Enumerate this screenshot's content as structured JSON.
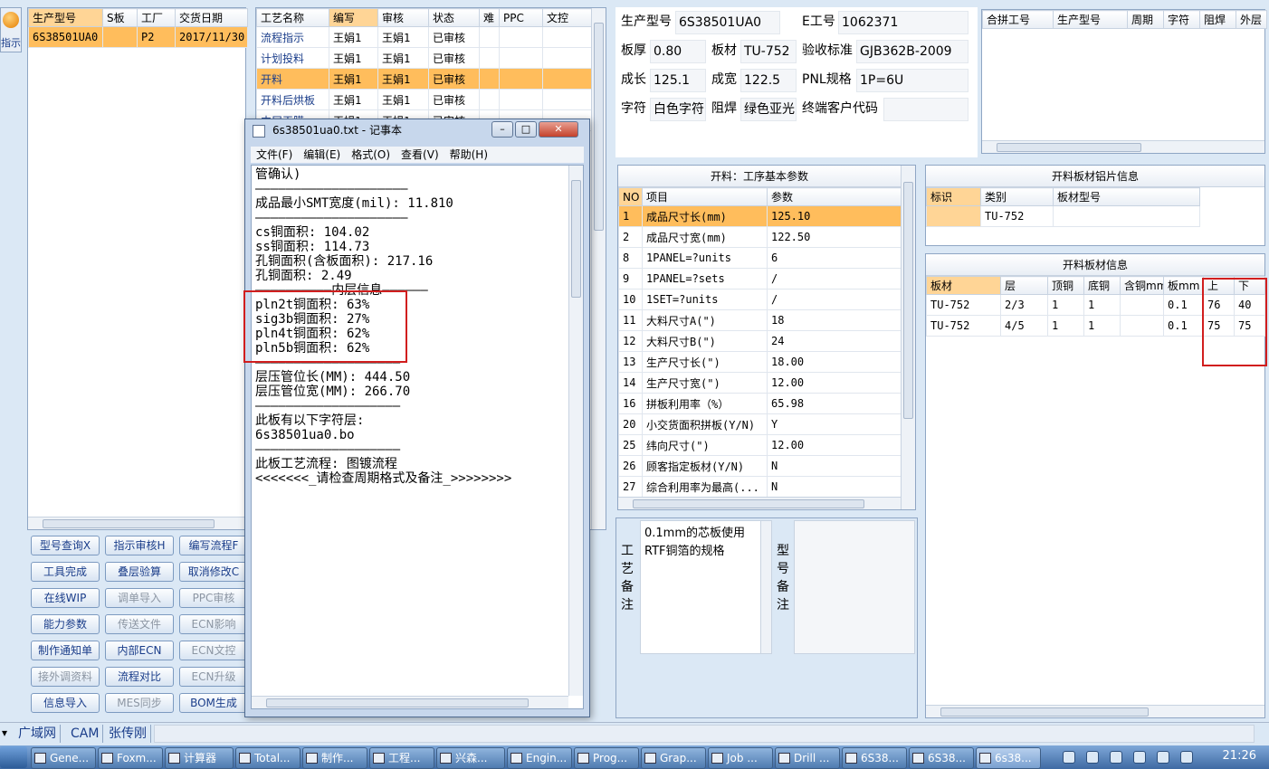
{
  "left_strip": {
    "icon_label": "指示"
  },
  "order_grid": {
    "headers": [
      "生产型号",
      "S板",
      "工厂",
      "交货日期"
    ],
    "rows": [
      [
        "6S38501UA0",
        "",
        "P2",
        "2017/11/30"
      ]
    ]
  },
  "process_grid": {
    "headers": [
      "工艺名称",
      "编写",
      "审核",
      "状态",
      "难",
      "PPC",
      "文控"
    ],
    "rows": [
      [
        "流程指示",
        "王娟1",
        "王娟1",
        "已审核",
        "",
        "",
        ""
      ],
      [
        "计划投料",
        "王娟1",
        "王娟1",
        "已审核",
        "",
        "",
        ""
      ],
      [
        "开料",
        "王娟1",
        "王娟1",
        "已审核",
        "",
        "",
        ""
      ],
      [
        "开料后烘板",
        "王娟1",
        "王娟1",
        "已审核",
        "",
        "",
        ""
      ],
      [
        "内层干膜",
        "王娟1",
        "王娟1",
        "已审核",
        "",
        "",
        ""
      ]
    ]
  },
  "buttons": [
    [
      "型号查询X",
      "指示审核H",
      "编写流程F"
    ],
    [
      "工具完成",
      "叠层验算",
      "取消修改C"
    ],
    [
      "在线WIP",
      "调单导入",
      "PPC审核"
    ],
    [
      "能力参数",
      "传送文件",
      "ECN影响"
    ],
    [
      "制作通知单",
      "内部ECN",
      "ECN文控"
    ],
    [
      "接外调资料",
      "流程对比",
      "ECN升级"
    ],
    [
      "信息导入",
      "MES同步",
      "BOM生成"
    ]
  ],
  "buttons_disabled": [
    [
      false,
      false,
      false
    ],
    [
      false,
      false,
      false
    ],
    [
      false,
      true,
      true
    ],
    [
      false,
      true,
      true
    ],
    [
      false,
      false,
      true
    ],
    [
      true,
      false,
      true
    ],
    [
      false,
      true,
      false
    ]
  ],
  "info": {
    "prod_model_lbl": "生产型号",
    "prod_model": "6S38501UA0",
    "e_no_lbl": "E工号",
    "e_no": "1062371",
    "thick_lbl": "板厚",
    "thick": "0.80",
    "material_lbl": "板材",
    "material": "TU-752",
    "std_lbl": "验收标准",
    "std": "GJB362B-2009",
    "len_lbl": "成长",
    "len": "125.1",
    "wid_lbl": "成宽",
    "wid": "122.5",
    "pnl_lbl": "PNL规格",
    "pnl": "1P=6U",
    "char_lbl": "字符",
    "char": "白色字符",
    "mask_lbl": "阻焊",
    "mask": "绿色亚光",
    "cust_lbl": "终端客户代码",
    "cust": ""
  },
  "merge_grid": {
    "headers": [
      "合拼工号",
      "生产型号",
      "周期",
      "字符",
      "阻焊",
      "外层"
    ]
  },
  "param_grid": {
    "title": "开料：工序基本参数",
    "headers": [
      "NO",
      "项目",
      "参数"
    ],
    "rows": [
      [
        "1",
        "成品尺寸长(mm)",
        "125.10"
      ],
      [
        "2",
        "成品尺寸宽(mm)",
        "122.50"
      ],
      [
        "8",
        "1PANEL=?units",
        "6"
      ],
      [
        "9",
        "1PANEL=?sets",
        "/"
      ],
      [
        "10",
        "1SET=?units",
        "/"
      ],
      [
        "11",
        "大料尺寸A(\")",
        "18"
      ],
      [
        "12",
        "大料尺寸B(\")",
        "24"
      ],
      [
        "13",
        "生产尺寸长(\")",
        "18.00"
      ],
      [
        "14",
        "生产尺寸宽(\")",
        "12.00"
      ],
      [
        "16",
        "拼板利用率（%）",
        "65.98"
      ],
      [
        "20",
        "小交货面积拼板(Y/N)",
        "Y"
      ],
      [
        "25",
        "纬向尺寸(\")",
        "12.00"
      ],
      [
        "26",
        "顾客指定板材(Y/N)",
        "N"
      ],
      [
        "27",
        "综合利用率为最高(...",
        "N"
      ]
    ]
  },
  "copper_grid": {
    "title": "开料板材铝片信息",
    "headers": [
      "标识",
      "类别",
      "板材型号"
    ],
    "rows": [
      [
        "",
        "TU-752",
        ""
      ]
    ]
  },
  "sheet_grid": {
    "title": "开料板材信息",
    "headers": [
      "板材",
      "层",
      "顶铜",
      "底铜",
      "含铜mm",
      "板mm",
      "上",
      "下"
    ],
    "rows": [
      [
        "TU-752",
        "2/3",
        "1",
        "1",
        "",
        "0.1",
        "76",
        "40"
      ],
      [
        "TU-752",
        "4/5",
        "1",
        "1",
        "",
        "0.1",
        "75",
        "75"
      ]
    ]
  },
  "process_note": {
    "label": "工艺备注",
    "text": "0.1mm的芯板使用RTF铜箔的规格"
  },
  "model_note": {
    "label": "型号备注",
    "text": ""
  },
  "notepad": {
    "title": "6s38501ua0.txt - 记事本",
    "menu": [
      "文件(F)",
      "编辑(E)",
      "格式(O)",
      "查看(V)",
      "帮助(H)"
    ],
    "content": "管确认)\n————————————————————\n成品最小SMT宽度(mil): 11.810\n————————————————————\ncs铜面积: 104.02\nss铜面积: 114.73\n孔铜面积(含板面积): 217.16\n孔铜面积: 2.49\n——————————内层信息——————\npln2t铜面积: 63%\nsig3b铜面积: 27%\npln4t铜面积: 62%\npln5b铜面积: 62%\n———————————————————\n层压管位长(MM): 444.50\n层压管位宽(MM): 266.70\n———————————————————\n此板有以下字符层:\n6s38501ua0.bo\n———————————————————\n此板工艺流程: 图镀流程\n<<<<<<<_请检查周期格式及备注_>>>>>>>>"
  },
  "status_bar": [
    "广域网",
    "CAM",
    "张传刚"
  ],
  "taskbar": {
    "items": [
      "Gene...",
      "Foxm...",
      "计算器",
      "Total...",
      "制作...",
      "工程...",
      "兴森...",
      "Engin...",
      "Prog...",
      "Grap...",
      "Job ...",
      "Drill ...",
      "6S38...",
      "6S38...",
      "6s38..."
    ],
    "clock": "21:26"
  },
  "colors": {
    "accent_row": "#ffbd5c",
    "highlight_box": "#d11e1e"
  }
}
